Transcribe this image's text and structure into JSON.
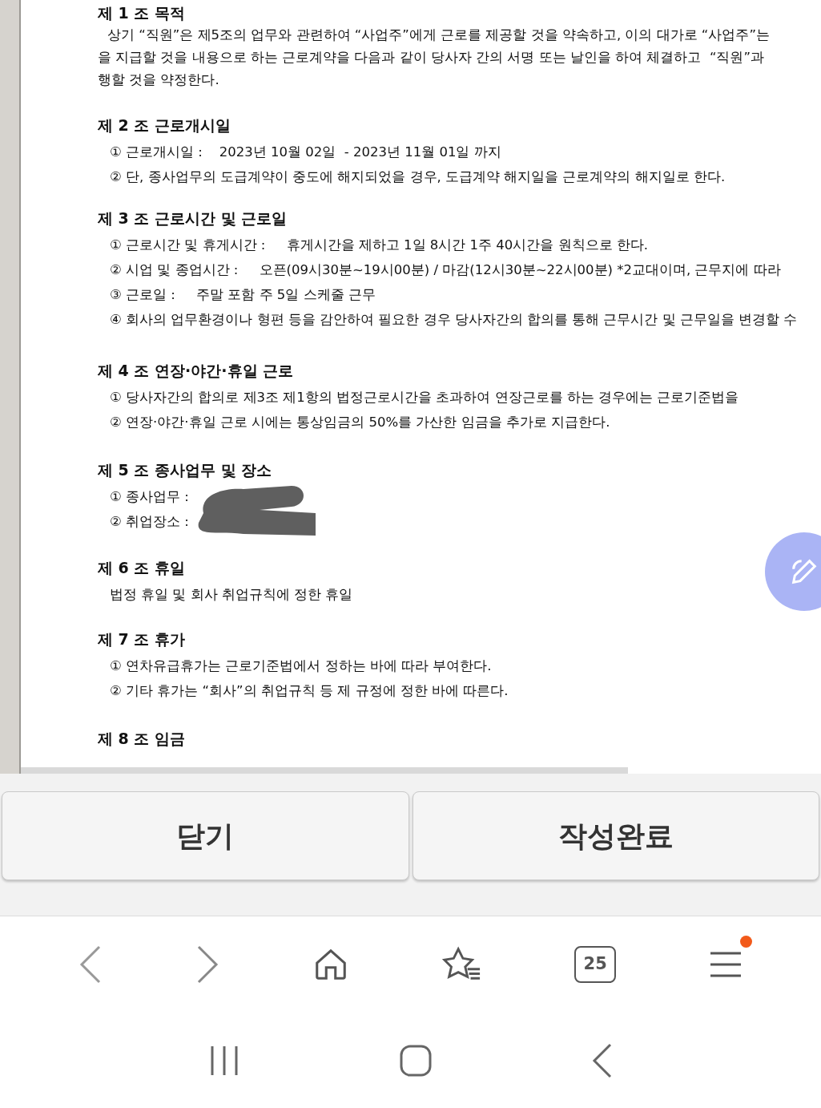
{
  "document": {
    "articles": [
      {
        "heading": "제 1 조 목적",
        "kind": "paragraph",
        "lines": [
          "상기 “직원”은 제5조의 업무와 관련하여 “사업주”에게 근로를 제공할 것을 약속하고, 이의 대가로 “사업주”는",
          "을 지급할 것을 내용으로 하는 근로계약을 다음과 같이 당사자 간의 서명 또는 날인을 하여 체결하고  “직원”과",
          "행할 것을 약정한다."
        ]
      },
      {
        "heading": "제 2 조 근로개시일",
        "kind": "items",
        "lines": [
          "① 근로개시일 :    2023년 10월 02일  - 2023년 11월 01일 까지",
          "② 단, 종사업무의 도급계약이 중도에 해지되었을 경우, 도급계약 해지일을 근로계약의 해지일로 한다."
        ]
      },
      {
        "heading": "제 3 조 근로시간 및 근로일",
        "kind": "items",
        "lines": [
          "① 근로시간 및 휴게시간 :     휴게시간을 제하고 1일 8시간 1주 40시간을 원칙으로 한다.",
          "② 시업 및 종업시간 :     오픈(09시30분~19시00분) / 마감(12시30분~22시00분) *2교대이며, 근무지에 따라",
          "③ 근로일 :     주말 포함 주 5일 스케줄 근무",
          "④ 회사의 업무환경이나 형편 등을 감안하여 필요한 경우 당사자간의 합의를 통해 근무시간 및 근무일을 변경할 수"
        ]
      },
      {
        "heading": "제 4 조 연장·야간·휴일 근로",
        "kind": "items",
        "lines": [
          "① 당사자간의 합의로 제3조 제1항의 법정근로시간을 초과하여 연장근로를 하는 경우에는 근로기준법을",
          "② 연장·야간·휴일 근로 시에는 통상임금의 50%를 가산한 임금을 추가로 지급한다."
        ]
      },
      {
        "heading": "제 5 조 종사업무 및 장소",
        "kind": "redacted",
        "lines": [
          "① 종사업무 :",
          "② 취업장소 :"
        ]
      },
      {
        "heading": "제 6 조 휴일",
        "kind": "items",
        "lines": [
          "법정 휴일 및 회사 취업규칙에 정한 휴일"
        ]
      },
      {
        "heading": "제 7 조 휴가",
        "kind": "items",
        "lines": [
          "① 연차유급휴가는 근로기준법에서 정하는 바에 따라 부여한다.",
          "② 기타 휴가는 “회사”의 취업규칙 등 제 규정에 정한 바에 따른다."
        ]
      },
      {
        "heading": "제 8 조 임금",
        "kind": "items"
      }
    ]
  },
  "buttons": [
    {
      "label": "닫기"
    },
    {
      "label": "작성완료"
    }
  ],
  "browser_toolbar": {
    "tab_count": "25",
    "menu_badge": true
  }
}
